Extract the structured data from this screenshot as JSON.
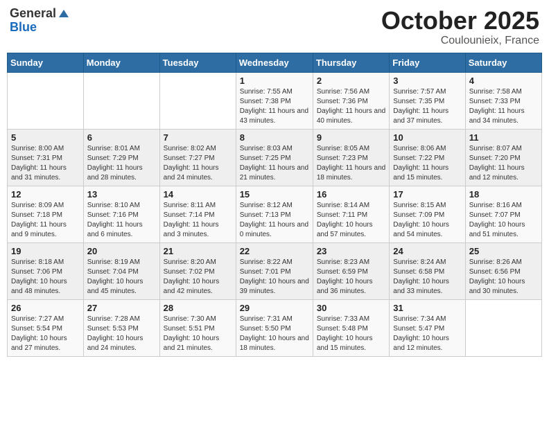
{
  "header": {
    "logo_general": "General",
    "logo_blue": "Blue",
    "month": "October 2025",
    "location": "Coulounieix, France"
  },
  "days_of_week": [
    "Sunday",
    "Monday",
    "Tuesday",
    "Wednesday",
    "Thursday",
    "Friday",
    "Saturday"
  ],
  "weeks": [
    [
      {
        "day": "",
        "info": ""
      },
      {
        "day": "",
        "info": ""
      },
      {
        "day": "",
        "info": ""
      },
      {
        "day": "1",
        "sunrise": "Sunrise: 7:55 AM",
        "sunset": "Sunset: 7:38 PM",
        "daylight": "Daylight: 11 hours and 43 minutes."
      },
      {
        "day": "2",
        "sunrise": "Sunrise: 7:56 AM",
        "sunset": "Sunset: 7:36 PM",
        "daylight": "Daylight: 11 hours and 40 minutes."
      },
      {
        "day": "3",
        "sunrise": "Sunrise: 7:57 AM",
        "sunset": "Sunset: 7:35 PM",
        "daylight": "Daylight: 11 hours and 37 minutes."
      },
      {
        "day": "4",
        "sunrise": "Sunrise: 7:58 AM",
        "sunset": "Sunset: 7:33 PM",
        "daylight": "Daylight: 11 hours and 34 minutes."
      }
    ],
    [
      {
        "day": "5",
        "sunrise": "Sunrise: 8:00 AM",
        "sunset": "Sunset: 7:31 PM",
        "daylight": "Daylight: 11 hours and 31 minutes."
      },
      {
        "day": "6",
        "sunrise": "Sunrise: 8:01 AM",
        "sunset": "Sunset: 7:29 PM",
        "daylight": "Daylight: 11 hours and 28 minutes."
      },
      {
        "day": "7",
        "sunrise": "Sunrise: 8:02 AM",
        "sunset": "Sunset: 7:27 PM",
        "daylight": "Daylight: 11 hours and 24 minutes."
      },
      {
        "day": "8",
        "sunrise": "Sunrise: 8:03 AM",
        "sunset": "Sunset: 7:25 PM",
        "daylight": "Daylight: 11 hours and 21 minutes."
      },
      {
        "day": "9",
        "sunrise": "Sunrise: 8:05 AM",
        "sunset": "Sunset: 7:23 PM",
        "daylight": "Daylight: 11 hours and 18 minutes."
      },
      {
        "day": "10",
        "sunrise": "Sunrise: 8:06 AM",
        "sunset": "Sunset: 7:22 PM",
        "daylight": "Daylight: 11 hours and 15 minutes."
      },
      {
        "day": "11",
        "sunrise": "Sunrise: 8:07 AM",
        "sunset": "Sunset: 7:20 PM",
        "daylight": "Daylight: 11 hours and 12 minutes."
      }
    ],
    [
      {
        "day": "12",
        "sunrise": "Sunrise: 8:09 AM",
        "sunset": "Sunset: 7:18 PM",
        "daylight": "Daylight: 11 hours and 9 minutes."
      },
      {
        "day": "13",
        "sunrise": "Sunrise: 8:10 AM",
        "sunset": "Sunset: 7:16 PM",
        "daylight": "Daylight: 11 hours and 6 minutes."
      },
      {
        "day": "14",
        "sunrise": "Sunrise: 8:11 AM",
        "sunset": "Sunset: 7:14 PM",
        "daylight": "Daylight: 11 hours and 3 minutes."
      },
      {
        "day": "15",
        "sunrise": "Sunrise: 8:12 AM",
        "sunset": "Sunset: 7:13 PM",
        "daylight": "Daylight: 11 hours and 0 minutes."
      },
      {
        "day": "16",
        "sunrise": "Sunrise: 8:14 AM",
        "sunset": "Sunset: 7:11 PM",
        "daylight": "Daylight: 10 hours and 57 minutes."
      },
      {
        "day": "17",
        "sunrise": "Sunrise: 8:15 AM",
        "sunset": "Sunset: 7:09 PM",
        "daylight": "Daylight: 10 hours and 54 minutes."
      },
      {
        "day": "18",
        "sunrise": "Sunrise: 8:16 AM",
        "sunset": "Sunset: 7:07 PM",
        "daylight": "Daylight: 10 hours and 51 minutes."
      }
    ],
    [
      {
        "day": "19",
        "sunrise": "Sunrise: 8:18 AM",
        "sunset": "Sunset: 7:06 PM",
        "daylight": "Daylight: 10 hours and 48 minutes."
      },
      {
        "day": "20",
        "sunrise": "Sunrise: 8:19 AM",
        "sunset": "Sunset: 7:04 PM",
        "daylight": "Daylight: 10 hours and 45 minutes."
      },
      {
        "day": "21",
        "sunrise": "Sunrise: 8:20 AM",
        "sunset": "Sunset: 7:02 PM",
        "daylight": "Daylight: 10 hours and 42 minutes."
      },
      {
        "day": "22",
        "sunrise": "Sunrise: 8:22 AM",
        "sunset": "Sunset: 7:01 PM",
        "daylight": "Daylight: 10 hours and 39 minutes."
      },
      {
        "day": "23",
        "sunrise": "Sunrise: 8:23 AM",
        "sunset": "Sunset: 6:59 PM",
        "daylight": "Daylight: 10 hours and 36 minutes."
      },
      {
        "day": "24",
        "sunrise": "Sunrise: 8:24 AM",
        "sunset": "Sunset: 6:58 PM",
        "daylight": "Daylight: 10 hours and 33 minutes."
      },
      {
        "day": "25",
        "sunrise": "Sunrise: 8:26 AM",
        "sunset": "Sunset: 6:56 PM",
        "daylight": "Daylight: 10 hours and 30 minutes."
      }
    ],
    [
      {
        "day": "26",
        "sunrise": "Sunrise: 7:27 AM",
        "sunset": "Sunset: 5:54 PM",
        "daylight": "Daylight: 10 hours and 27 minutes."
      },
      {
        "day": "27",
        "sunrise": "Sunrise: 7:28 AM",
        "sunset": "Sunset: 5:53 PM",
        "daylight": "Daylight: 10 hours and 24 minutes."
      },
      {
        "day": "28",
        "sunrise": "Sunrise: 7:30 AM",
        "sunset": "Sunset: 5:51 PM",
        "daylight": "Daylight: 10 hours and 21 minutes."
      },
      {
        "day": "29",
        "sunrise": "Sunrise: 7:31 AM",
        "sunset": "Sunset: 5:50 PM",
        "daylight": "Daylight: 10 hours and 18 minutes."
      },
      {
        "day": "30",
        "sunrise": "Sunrise: 7:33 AM",
        "sunset": "Sunset: 5:48 PM",
        "daylight": "Daylight: 10 hours and 15 minutes."
      },
      {
        "day": "31",
        "sunrise": "Sunrise: 7:34 AM",
        "sunset": "Sunset: 5:47 PM",
        "daylight": "Daylight: 10 hours and 12 minutes."
      },
      {
        "day": "",
        "info": ""
      }
    ]
  ]
}
